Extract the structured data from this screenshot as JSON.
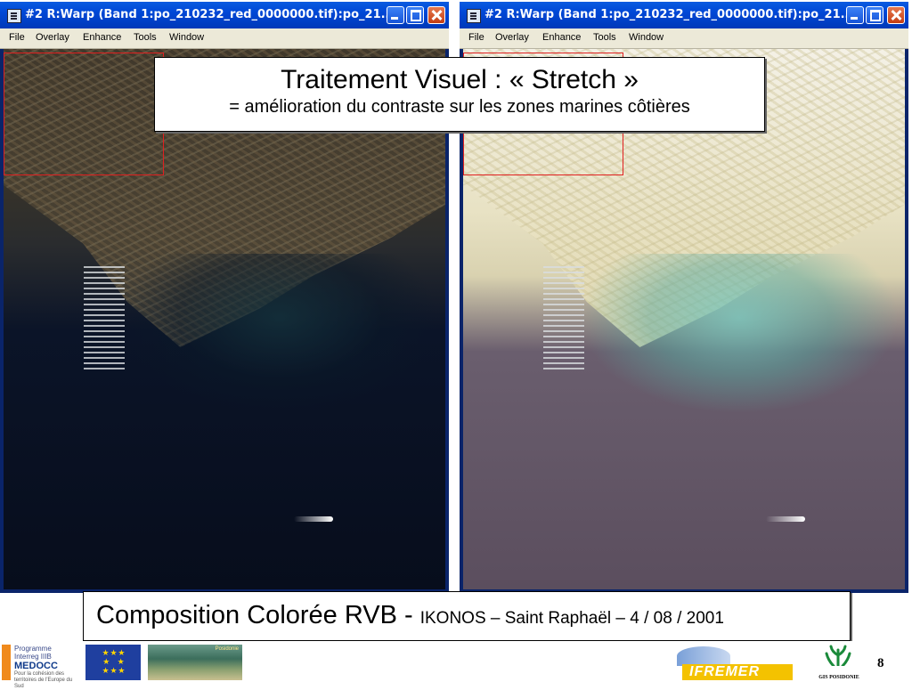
{
  "windows": [
    {
      "title": "#2 R:Warp (Band 1:po_210232_red_0000000.tif):po_21...",
      "menu": [
        "File",
        "Overlay",
        "Enhance",
        "Tools",
        "Window"
      ]
    },
    {
      "title": "#2 R:Warp (Band 1:po_210232_red_0000000.tif):po_21...",
      "menu": [
        "File",
        "Overlay",
        "Enhance",
        "Tools",
        "Window"
      ]
    }
  ],
  "slide": {
    "title": "Traitement Visuel : « Stretch »",
    "subtitle": "= amélioration du contraste sur les zones marines côtières",
    "caption_main": "Composition Colorée RVB - ",
    "caption_detail": "IKONOS – Saint Raphaël – 4 / 08 / 2001",
    "page_number": "8"
  },
  "footer": {
    "interreg": {
      "line1": "Programme",
      "line2": "Interreg IIIB",
      "name": "MEDOCC",
      "tagline": "Pour la cohésion des territoires de l'Europe du Sud"
    },
    "posidonie_label": "Posidonie",
    "ifremer_label": "IFREMER",
    "gis_label": "GIS POSIDONIE"
  }
}
